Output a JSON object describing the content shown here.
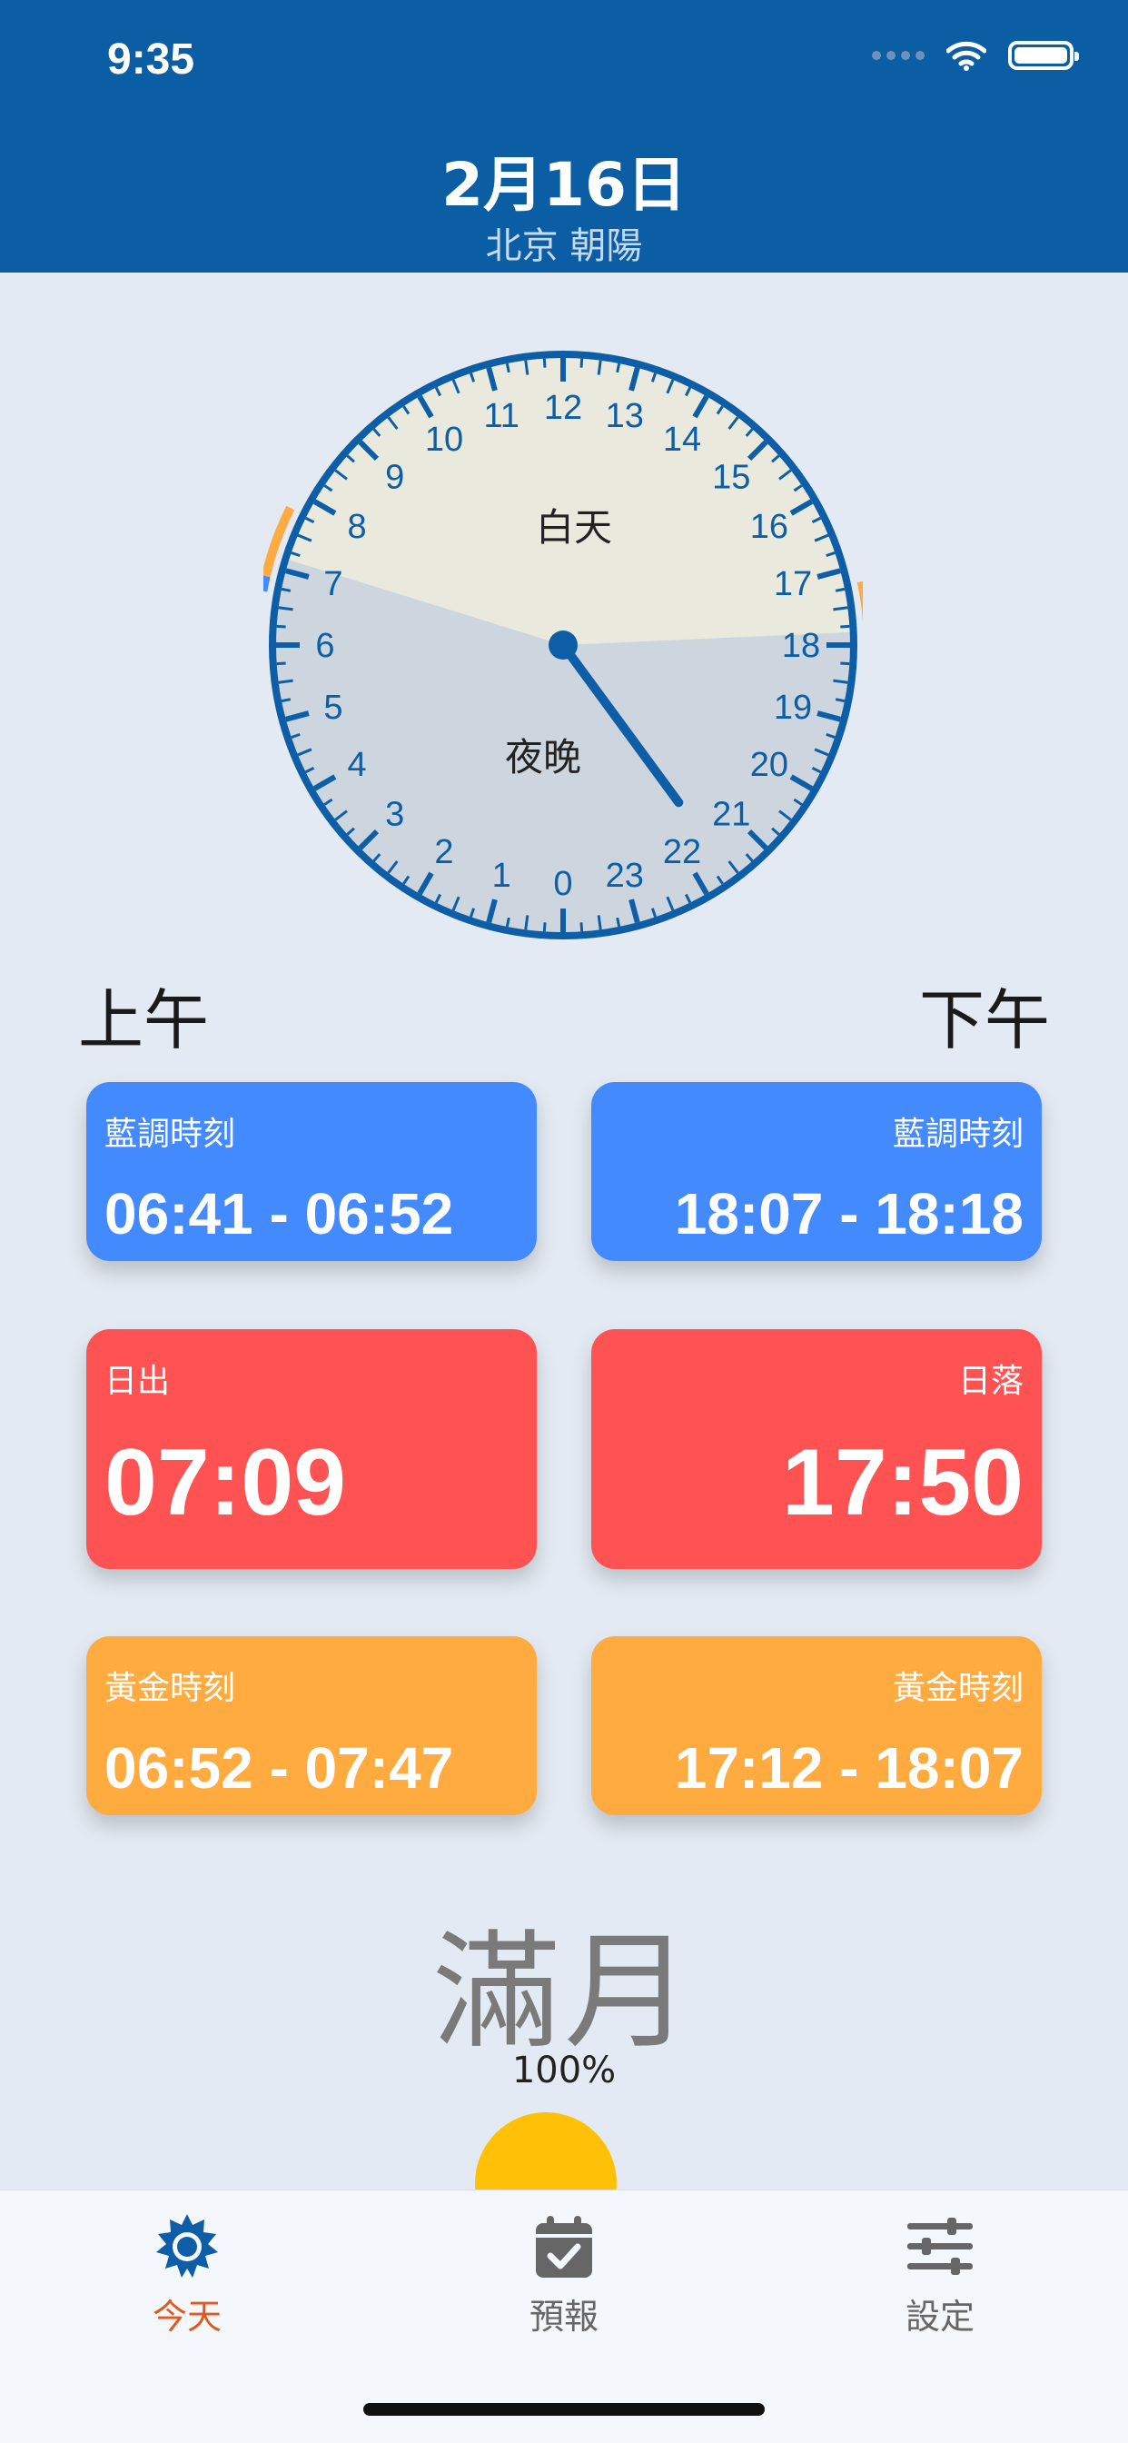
{
  "status_bar": {
    "time": "9:35"
  },
  "header": {
    "date": "2月16日",
    "location": "北京 朝陽"
  },
  "dial": {
    "day_label": "白天",
    "night_label": "夜晚",
    "hour_labels": [
      "0",
      "1",
      "2",
      "3",
      "4",
      "5",
      "6",
      "7",
      "8",
      "9",
      "10",
      "11",
      "12",
      "13",
      "14",
      "15",
      "16",
      "17",
      "18",
      "19",
      "20",
      "21",
      "22",
      "23"
    ],
    "sunrise_hour": 7.15,
    "sunset_hour": 17.83,
    "current_hour": 21.58,
    "colors": {
      "rim": "#0d5ea6",
      "day": "#e9eadd",
      "night": "#cdd5de",
      "golden": "#ffab40",
      "blue": "#448aff"
    }
  },
  "labels": {
    "am": "上午",
    "pm": "下午"
  },
  "cards": {
    "blue_am": {
      "label": "藍調時刻",
      "time": "06:41 - 06:52"
    },
    "blue_pm": {
      "label": "藍調時刻",
      "time": "18:07 - 18:18"
    },
    "sunrise": {
      "label": "日出",
      "time": "07:09"
    },
    "sunset": {
      "label": "日落",
      "time": "17:50"
    },
    "golden_am": {
      "label": "黃金時刻",
      "time": "06:52 - 07:47"
    },
    "golden_pm": {
      "label": "黃金時刻",
      "time": "17:12 - 18:07"
    }
  },
  "moon": {
    "phase": "滿月",
    "illumination": "100%"
  },
  "tabbar": {
    "tabs": [
      {
        "label": "今天",
        "icon": "sun-icon",
        "active": true
      },
      {
        "label": "預報",
        "icon": "calendar-check-icon",
        "active": false
      },
      {
        "label": "設定",
        "icon": "sliders-icon",
        "active": false
      }
    ]
  }
}
